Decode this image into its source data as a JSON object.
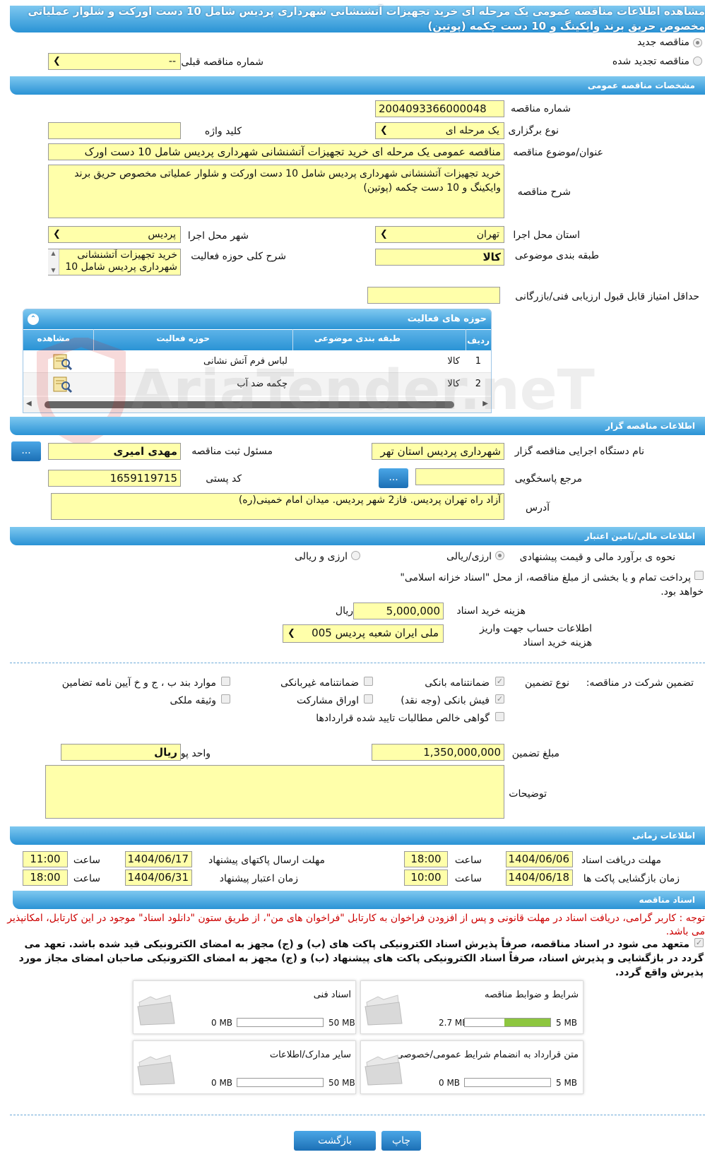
{
  "title": "مشاهده اطلاعات مناقصه عمومی یک مرحله ای خرید تجهیزات آتشنشانی شهرداری پردیس شامل 10 دست اورکت و شلوار عملیاتی مخصوص حریق برند وایکینگ و 10 دست چکمه (پوتین)",
  "top": {
    "new_tender": "مناقصه جدید",
    "renewed_tender": "مناقصه تجدید شده",
    "prev_number_label": "شماره مناقصه قبلی",
    "prev_number_value": "--"
  },
  "general": {
    "header": "مشخصات مناقصه عمومی",
    "number_label": "شماره مناقصه",
    "number_value": "2004093366000048",
    "type_label": "نوع برگزاری",
    "type_value": "یک مرحله ای",
    "keyword_label": "کلید واژه",
    "keyword_value": "",
    "subject_label": "عنوان/موضوع مناقصه",
    "subject_value": "مناقصه عمومی یک مرحله ای خرید تجهیزات آتشنشانی شهرداری پردیس شامل 10 دست اورک",
    "desc_label": "شرح مناقصه",
    "desc_value": "خرید تجهیزات آتشنشانی شهرداری پردیس شامل 10 دست اورکت و شلوار عملیاتی مخصوص حریق برند وایکینگ و 10 دست چکمه (پوتین)",
    "province_label": "استان محل اجرا",
    "province_value": "تهران",
    "city_label": "شهر محل اجرا",
    "city_value": "پردیس",
    "category_label": "طبقه بندی موضوعی",
    "category_value": "کالا",
    "scope_label": "شرح کلی حوزه فعالیت",
    "scope_value": "خرید تجهیزات آتشنشانی شهرداری پردیس شامل 10",
    "min_score_label": "حداقل امتیاز قابل قبول ارزیابی فنی/بازرگانی",
    "min_score_value": ""
  },
  "activity_grid": {
    "title": "حوزه های فعالیت",
    "columns": [
      "ردیف",
      "طبقه بندی موضوعی",
      "حوزه فعالیت",
      "مشاهده"
    ],
    "rows": [
      {
        "no": "1",
        "category": "کالا",
        "activity": "لباس فرم آتش نشانی"
      },
      {
        "no": "2",
        "category": "کالا",
        "activity": "چکمه ضد آب"
      }
    ]
  },
  "organizer": {
    "header": "اطلاعات مناقصه گزار",
    "org_label": "نام دستگاه اجرایی مناقصه گزار",
    "org_value": "شهرداری پردیس استان تهر",
    "responsible_label": "مسئول ثبت مناقصه",
    "responsible_value": "مهدی امیری",
    "ref_label": "مرجع پاسخگویی",
    "ref_value": "",
    "postal_label": "کد پستی",
    "postal_value": "1659119715",
    "address_label": "آدرس",
    "address_value": "آزاد راه تهران پردیس. فاز2 شهر پردیس. میدان امام خمینی(ره)",
    "dots": "..."
  },
  "finance": {
    "header": "اطلاعات مالی/تامین اعتبار",
    "estimate_label": "نحوه ی برآورد مالی و قیمت پیشنهادی",
    "opt_rial_currency": "ارزی/ریالی",
    "opt_currency_and_rial": "ارزی و ریالی",
    "treasury_text": "پرداخت تمام و یا بخشی از مبلغ مناقصه، از محل \"اسناد خزانه اسلامی\" خواهد بود.",
    "doc_cost_label": "هزینه خرید اسناد",
    "doc_cost_value": "5,000,000",
    "doc_cost_unit": "ریال",
    "account_label": "اطلاعات حساب جهت واریز هزینه خرید اسناد",
    "account_value": "ملی ایران شعبه پردیس 005"
  },
  "guarantee": {
    "label": "تضمین شرکت در مناقصه:",
    "type_label": "نوع تضمین",
    "opt_bank_guarantee": "ضمانتنامه بانکی",
    "opt_nonbank_guarantee": "ضمانتنامه غیربانکی",
    "opt_items": "موارد بند ب ، ج و خ آیین نامه تضامین",
    "opt_cash": "فیش بانکی (وجه نقد)",
    "opt_bonds": "اوراق مشارکت",
    "opt_property": "وثیقه ملکی",
    "opt_receivables": "گواهی خالص مطالبات تایید شده قراردادها",
    "amount_label": "مبلغ تضمین",
    "amount_value": "1,350,000,000",
    "currency_label": "واحد پول",
    "currency_value": "ریال",
    "notes_label": "توضیحات",
    "notes_value": ""
  },
  "timing": {
    "header": "اطلاعات زمانی",
    "doc_receive_label": "مهلت دریافت اسناد",
    "doc_receive_date": "1404/06/06",
    "doc_receive_time": "18:00",
    "send_label": "مهلت ارسال پاکتهای پیشنهاد",
    "send_date": "1404/06/17",
    "send_time": "11:00",
    "open_label": "زمان بازگشایی پاکت ها",
    "open_date": "1404/06/18",
    "open_time": "10:00",
    "validity_label": "زمان اعتبار پیشنهاد",
    "validity_date": "1404/06/31",
    "validity_time": "18:00",
    "time_label": "ساعت"
  },
  "documents": {
    "header": "اسناد مناقصه",
    "note": "توجه : کاربر گرامی، دریافت اسناد در مهلت قانونی و پس از افزودن فراخوان به کارتابل \"فراخوان های من\"، از طریق ستون \"دانلود اسناد\" موجود در این کارتابل، امکانپذیر می باشد.",
    "commit": "متعهد می شود در اسناد مناقصه، صرفاً پذیرش اسناد الکترونیکی پاکت های (ب) و (ج) مجهز به امضای الکترونیکی قید شده باشد. تعهد می گردد در بازگشایی و پذیرش اسناد، صرفاً اسناد الکترونیکی پاکت های پیشنهاد (ب) و (ج) مجهز به امضای الکترونیکی صاحبان امضای مجاز مورد پذیرش واقع گردد.",
    "files": [
      {
        "title": "شرایط و ضوابط مناقصه",
        "size": "2.7 MB",
        "max": "5 MB",
        "fill": 0.54
      },
      {
        "title": "اسناد فنی",
        "size": "0 MB",
        "max": "50 MB",
        "fill": 0
      },
      {
        "title": "متن قرارداد به انضمام شرایط عمومی/خصوصی",
        "size": "0 MB",
        "max": "5 MB",
        "fill": 0
      },
      {
        "title": "سایر مدارک/اطلاعات",
        "size": "0 MB",
        "max": "50 MB",
        "fill": 0
      }
    ]
  },
  "buttons": {
    "print": "چاپ",
    "back": "بازگشت"
  },
  "watermark": "AriaTender.neT",
  "colors": {
    "field": "#ffffaa",
    "header_blue": "#2a93d5",
    "progress_green": "#8dc63f",
    "note_red": "#cc0000"
  }
}
